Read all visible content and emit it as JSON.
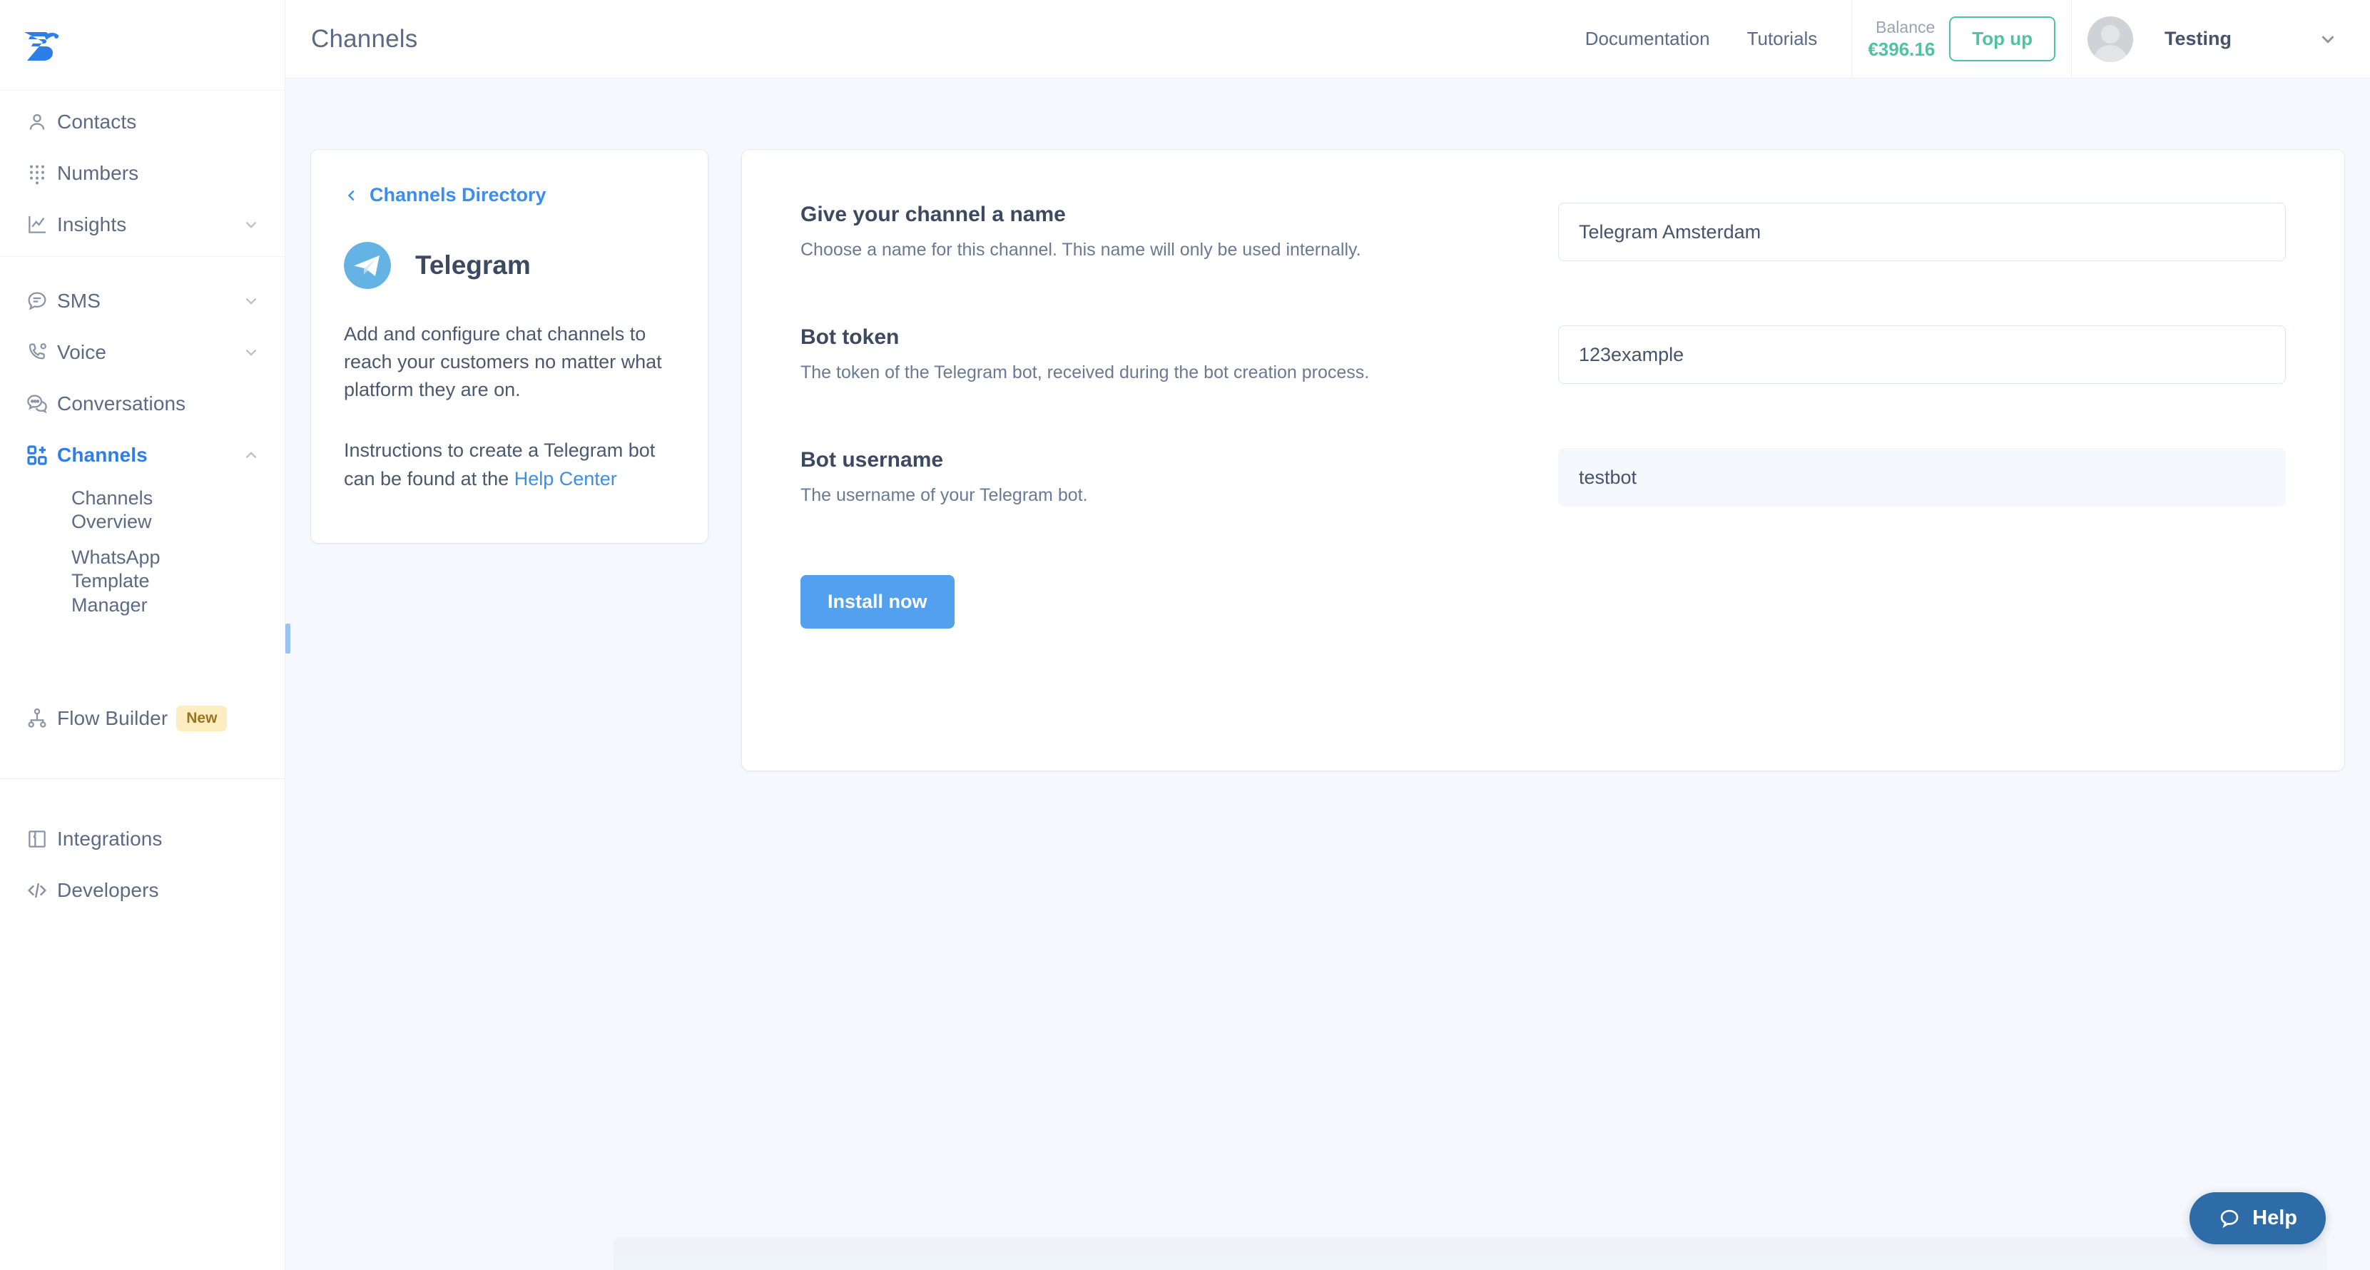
{
  "sidebar": {
    "logo_name": "messagebird-logo",
    "groups": [
      {
        "items": [
          {
            "label": "Contacts",
            "icon": "person-icon",
            "expandable": false,
            "active": false
          },
          {
            "label": "Numbers",
            "icon": "dialpad-icon",
            "expandable": false,
            "active": false
          },
          {
            "label": "Insights",
            "icon": "chart-icon",
            "expandable": true,
            "active": false
          }
        ]
      },
      {
        "items": [
          {
            "label": "SMS",
            "icon": "sms-bubble-icon",
            "expandable": true,
            "active": false
          },
          {
            "label": "Voice",
            "icon": "phone-icon",
            "expandable": true,
            "active": false
          },
          {
            "label": "Conversations",
            "icon": "conversations-icon",
            "expandable": false,
            "active": false
          },
          {
            "label": "Channels",
            "icon": "channels-grid-icon",
            "expandable": true,
            "active": true
          }
        ],
        "subitems": [
          "Channels Overview",
          "WhatsApp Template Manager"
        ]
      },
      {
        "items": [
          {
            "label": "Flow Builder",
            "icon": "flow-builder-icon",
            "expandable": false,
            "active": false,
            "badge": "New"
          }
        ]
      },
      {
        "items": [
          {
            "label": "Integrations",
            "icon": "integrations-icon",
            "expandable": false,
            "active": false
          },
          {
            "label": "Developers",
            "icon": "code-icon",
            "expandable": false,
            "active": false
          }
        ]
      }
    ]
  },
  "header": {
    "page_title": "Channels",
    "links": [
      "Documentation",
      "Tutorials"
    ],
    "balance_label": "Balance",
    "balance_amount": "€396.16",
    "topup_label": "Top up",
    "user_name": "Testing",
    "user_chevron": "chevron-down-icon"
  },
  "info_panel": {
    "back_link": "Channels Directory",
    "channel_name": "Telegram",
    "channel_icon": "telegram-icon",
    "paragraph_1": "Add and configure chat channels to reach your customers no matter what platform they are on.",
    "paragraph_2_prefix": "Instructions to create a Telegram bot can be found at the ",
    "paragraph_2_link": "Help Center"
  },
  "form": {
    "fields": [
      {
        "label": "Give your channel a name",
        "help": "Choose a name for this channel. This name will only be used internally.",
        "value": "Telegram Amsterdam",
        "placeholder": "",
        "disabled": false,
        "name": "channel-name-input"
      },
      {
        "label": "Bot token",
        "help": "The token of the Telegram bot, received during the bot creation process.",
        "value": "123example",
        "placeholder": "",
        "disabled": false,
        "name": "bot-token-input"
      },
      {
        "label": "Bot username",
        "help": "The username of your Telegram bot.",
        "value": "testbot",
        "placeholder": "",
        "disabled": true,
        "name": "bot-username-input"
      }
    ],
    "submit_label": "Install now"
  },
  "help_widget": {
    "label": "Help",
    "icon": "chat-bubble-icon"
  },
  "colors": {
    "brand_blue": "#2e7eea",
    "link_blue": "#3b8ef0",
    "button_blue": "#53a0ef",
    "balance_green": "#4ec3a0",
    "badge_bg": "#fdeec2",
    "badge_text": "#9a7420",
    "help_blue": "#2e6ca8",
    "page_bg": "#f5f8fc",
    "telegram_blue": "#64b3e4"
  }
}
